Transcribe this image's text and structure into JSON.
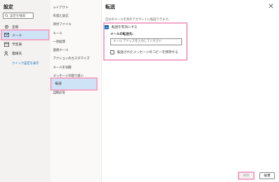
{
  "settings": {
    "title": "設定",
    "search_placeholder": "設定を検索",
    "quick_settings_link": "クイック設定を表示",
    "nav": [
      {
        "label": "全般",
        "icon": "gear-icon"
      },
      {
        "label": "メール",
        "icon": "mail-icon",
        "selected": true
      },
      {
        "label": "予定表",
        "icon": "calendar-icon"
      },
      {
        "label": "連絡先",
        "icon": "people-icon"
      }
    ]
  },
  "mail_submenu": [
    "レイアウト",
    "作成と返信",
    "添付ファイル",
    "ルール",
    "一括処理",
    "迷惑メール",
    "アクションのカスタマイズ",
    "メールを同期",
    "メッセージの取り扱い",
    "転送",
    "自動応答"
  ],
  "forwarding": {
    "title": "転送",
    "description": "自分のメールを別のアカウントに転送できます。",
    "enable_label": "転送を有効にする",
    "enable_checked": true,
    "address_label": "メールの転送先:",
    "address_placeholder": "メール アドレスを入力してください",
    "keep_copy_label": "転送されたメッセージのコピーを保持する",
    "keep_copy_checked": false
  },
  "footer": {
    "save_label": "保存",
    "discard_label": "破棄"
  },
  "colors": {
    "accent": "#0f6cbd",
    "selection": "#cfe3f7",
    "highlight_outline": "#f2a7c7"
  }
}
